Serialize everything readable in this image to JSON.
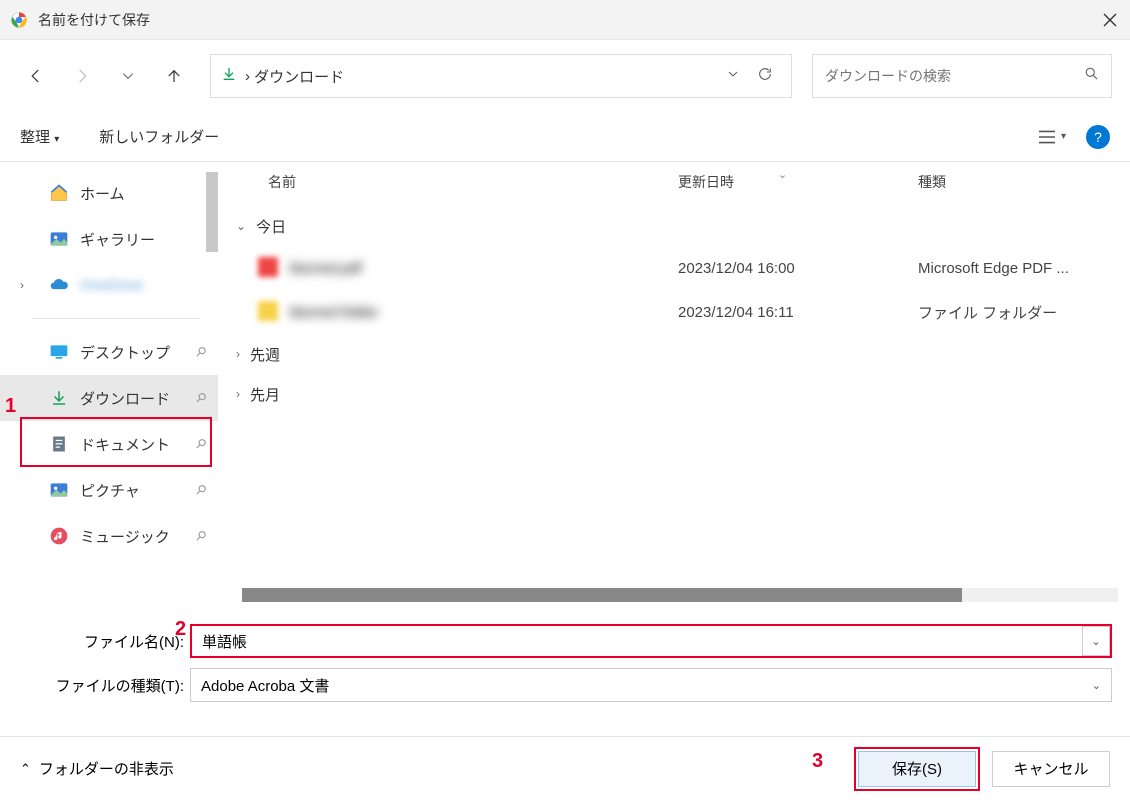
{
  "titlebar": {
    "title": "名前を付けて保存"
  },
  "nav": {
    "crumb_location": "ダウンロード",
    "search_placeholder": "ダウンロードの検索"
  },
  "toolbar": {
    "organize": "整理",
    "newfolder": "新しいフォルダー"
  },
  "sidebar": {
    "home": "ホーム",
    "gallery": "ギャラリー",
    "onedrive": "OneDrive",
    "desktop": "デスクトップ",
    "downloads": "ダウンロード",
    "documents": "ドキュメント",
    "pictures": "ピクチャ",
    "music": "ミュージック"
  },
  "columns": {
    "name": "名前",
    "date": "更新日時",
    "type": "種類"
  },
  "groups": {
    "today": "今日",
    "lastweek": "先週",
    "lastmonth": "先月"
  },
  "files": [
    {
      "name": "blurred.pdf",
      "date": "2023/12/04 16:00",
      "type": "Microsoft Edge PDF ..."
    },
    {
      "name": "blurred folder",
      "date": "2023/12/04 16:11",
      "type": "ファイル フォルダー"
    }
  ],
  "fields": {
    "filename_label": "ファイル名(N):",
    "filename_value": "単語帳",
    "filetype_label": "ファイルの種類(T):",
    "filetype_value": "Adobe Acroba 文書"
  },
  "footer": {
    "hide": "フォルダーの非表示",
    "save": "保存(S)",
    "cancel": "キャンセル"
  },
  "annotations": {
    "n1": "1",
    "n2": "2",
    "n3": "3"
  }
}
